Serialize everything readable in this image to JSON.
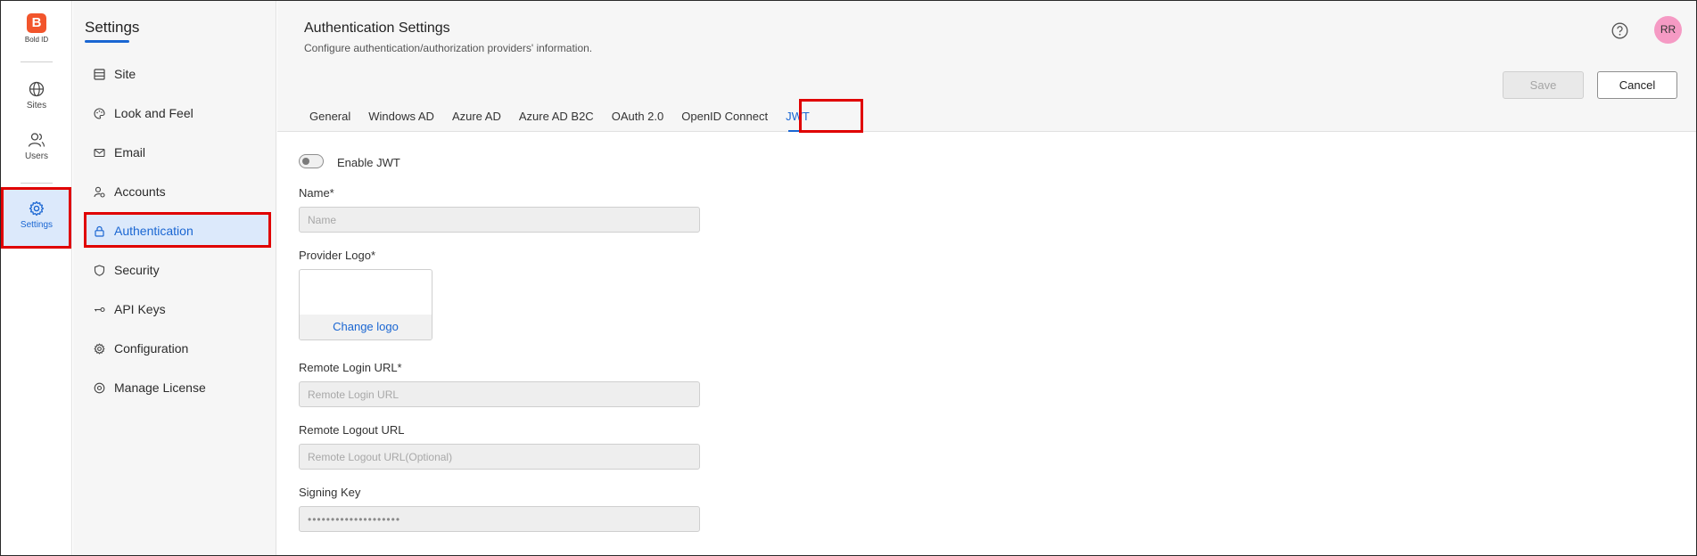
{
  "brand": {
    "name": "Bold ID",
    "accent": "#1a66d2",
    "logo_color": "#f2552c"
  },
  "rail": {
    "items": [
      {
        "label": "Sites",
        "icon": "globe-icon"
      },
      {
        "label": "Users",
        "icon": "users-icon"
      },
      {
        "label": "Settings",
        "icon": "gear-icon",
        "active": true
      }
    ]
  },
  "sidebar": {
    "title": "Settings",
    "items": [
      {
        "label": "Site",
        "icon": "site-icon"
      },
      {
        "label": "Look and Feel",
        "icon": "palette-icon"
      },
      {
        "label": "Email",
        "icon": "mail-icon"
      },
      {
        "label": "Accounts",
        "icon": "accounts-icon"
      },
      {
        "label": "Authentication",
        "icon": "lock-icon",
        "active": true
      },
      {
        "label": "Security",
        "icon": "shield-icon"
      },
      {
        "label": "API Keys",
        "icon": "key-icon"
      },
      {
        "label": "Configuration",
        "icon": "gear-icon"
      },
      {
        "label": "Manage License",
        "icon": "license-icon"
      }
    ]
  },
  "header": {
    "title": "Authentication Settings",
    "subtitle": "Configure authentication/authorization providers' information.",
    "avatar": "RR",
    "save_label": "Save",
    "cancel_label": "Cancel"
  },
  "tabs": [
    "General",
    "Windows AD",
    "Azure AD",
    "Azure AD B2C",
    "OAuth 2.0",
    "OpenID Connect",
    "JWT"
  ],
  "active_tab": "JWT",
  "form": {
    "enable_label": "Enable JWT",
    "enabled": false,
    "name_label": "Name*",
    "name_placeholder": "Name",
    "logo_label": "Provider Logo*",
    "change_logo": "Change logo",
    "login_label": "Remote Login URL*",
    "login_placeholder": "Remote Login URL",
    "logout_label": "Remote Logout URL",
    "logout_placeholder": "Remote Logout URL(Optional)",
    "signing_label": "Signing Key",
    "signing_value": "••••••••••••••••••••"
  }
}
